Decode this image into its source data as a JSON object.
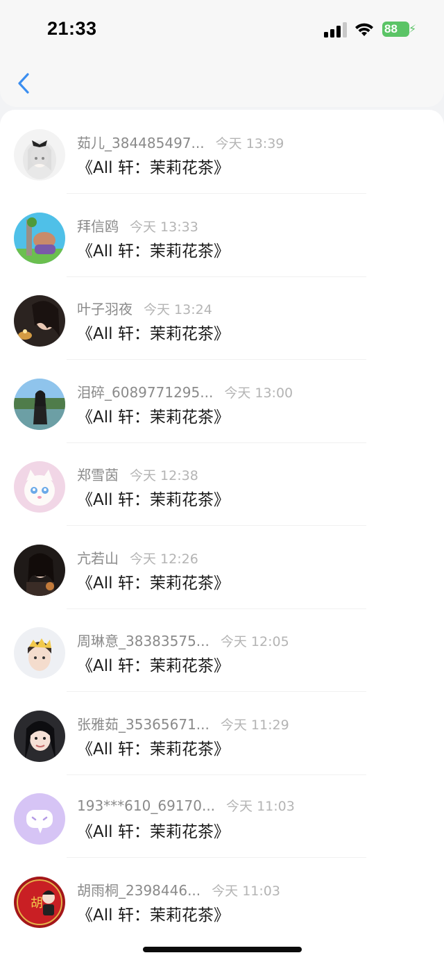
{
  "status_bar": {
    "time": "21:33",
    "battery": "88"
  },
  "nav": {
    "back_icon": "chevron-left-icon"
  },
  "messages": [
    {
      "name": "茹儿_384485497...",
      "time": "今天 13:39",
      "title": "《All 轩：茉莉花茶》",
      "avatar": "anime-girl"
    },
    {
      "name": "拜信鸥",
      "time": "今天 13:33",
      "title": "《All 轩：茉莉花茶》",
      "avatar": "cartoon-character"
    },
    {
      "name": "叶子羽夜",
      "time": "今天 13:24",
      "title": "《All 轩：茉莉花茶》",
      "avatar": "photo-girl-candle"
    },
    {
      "name": "泪碎_6089771295...",
      "time": "今天 13:00",
      "title": "《All 轩：茉莉花茶》",
      "avatar": "photo-girl-lake"
    },
    {
      "name": "郑雪茵",
      "time": "今天 12:38",
      "title": "《All 轩：茉莉花茶》",
      "avatar": "cartoon-cat"
    },
    {
      "name": "亢若山",
      "time": "今天 12:26",
      "title": "《All 轩：茉莉花茶》",
      "avatar": "photo-girl-dark"
    },
    {
      "name": "周琳意_38383575...",
      "time": "今天 12:05",
      "title": "《All 轩：茉莉花茶》",
      "avatar": "photo-girl-crown"
    },
    {
      "name": "张雅茹_35365671...",
      "time": "今天 11:29",
      "title": "《All 轩：茉莉花茶》",
      "avatar": "photo-girl-smile"
    },
    {
      "name": "193***610_69170...",
      "time": "今天 11:03",
      "title": "《All 轩：茉莉花茶》",
      "avatar": "default-chat-bubble"
    },
    {
      "name": "胡雨桐_2398446...",
      "time": "今天 11:03",
      "title": "《All 轩：茉莉花茶》",
      "avatar": "red-badge-hu",
      "avatar_text": "胡"
    }
  ],
  "colors": {
    "accent": "#3b8ef0",
    "default_avatar_bg": "#d6c4f5",
    "battery": "#5bc466"
  }
}
